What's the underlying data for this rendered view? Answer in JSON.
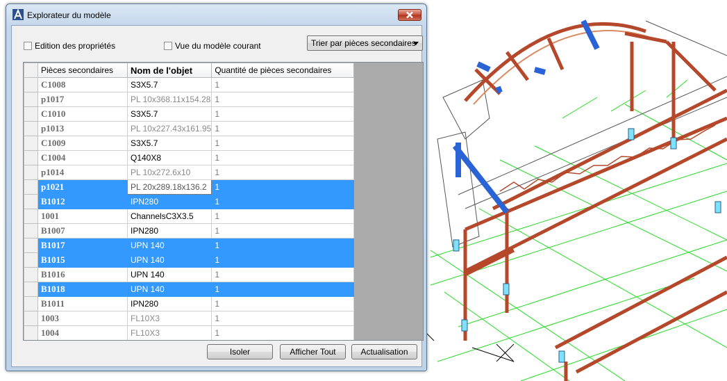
{
  "dialog": {
    "title": "Explorateur du modèle",
    "edit_properties_label": "Edition des propriétés",
    "current_model_view_label": "Vue du modèle courant",
    "sort_selected": "Trier par pièces secondaires",
    "buttons": {
      "isolate": "Isoler",
      "show_all": "Afficher Tout",
      "refresh": "Actualisation"
    }
  },
  "table": {
    "headers": [
      "Pièces secondaires",
      "Nom de l'objet",
      "Quantité de pièces secondaires"
    ],
    "rows": [
      {
        "part": "C1008",
        "name": "S3X5.7",
        "qty": "1",
        "selected": false,
        "grey": false
      },
      {
        "part": "p1017",
        "name": "PL 10x368.11x154.28",
        "qty": "1",
        "selected": false,
        "grey": true
      },
      {
        "part": "C1010",
        "name": "S3X5.7",
        "qty": "1",
        "selected": false,
        "grey": false
      },
      {
        "part": "p1013",
        "name": "PL 10x227.43x161.95",
        "qty": "1",
        "selected": false,
        "grey": true
      },
      {
        "part": "C1009",
        "name": "S3X5.7",
        "qty": "1",
        "selected": false,
        "grey": false
      },
      {
        "part": "C1004",
        "name": "Q140X8",
        "qty": "1",
        "selected": false,
        "grey": false
      },
      {
        "part": "p1014",
        "name": "PL 10x272.6x10",
        "qty": "1",
        "selected": false,
        "grey": true
      },
      {
        "part": "p1021",
        "name": "PL 20x289.18x136.2",
        "qty": "1",
        "selected": true,
        "grey": true,
        "editing": true
      },
      {
        "part": "B1012",
        "name": "IPN280",
        "qty": "1",
        "selected": true,
        "grey": false
      },
      {
        "part": "1001",
        "name": "ChannelsC3X3.5",
        "qty": "1",
        "selected": false,
        "grey": false
      },
      {
        "part": "B1007",
        "name": "IPN280",
        "qty": "1",
        "selected": false,
        "grey": false
      },
      {
        "part": "B1017",
        "name": "UPN 140",
        "qty": "1",
        "selected": true,
        "grey": false
      },
      {
        "part": "B1015",
        "name": "UPN 140",
        "qty": "1",
        "selected": true,
        "grey": false
      },
      {
        "part": "B1016",
        "name": "UPN 140",
        "qty": "1",
        "selected": false,
        "grey": false
      },
      {
        "part": "B1018",
        "name": "UPN 140",
        "qty": "1",
        "selected": true,
        "grey": false
      },
      {
        "part": "B1011",
        "name": "IPN280",
        "qty": "1",
        "selected": false,
        "grey": false
      },
      {
        "part": "1003",
        "name": "FL10X3",
        "qty": "1",
        "selected": false,
        "grey": true
      },
      {
        "part": "1004",
        "name": "FL10X3",
        "qty": "1",
        "selected": false,
        "grey": true
      }
    ]
  },
  "colors": {
    "selection": "#3399ff",
    "steel_beam": "#b5472a",
    "highlight_member": "#2a63d6",
    "grid_lines": "#22dd22"
  }
}
